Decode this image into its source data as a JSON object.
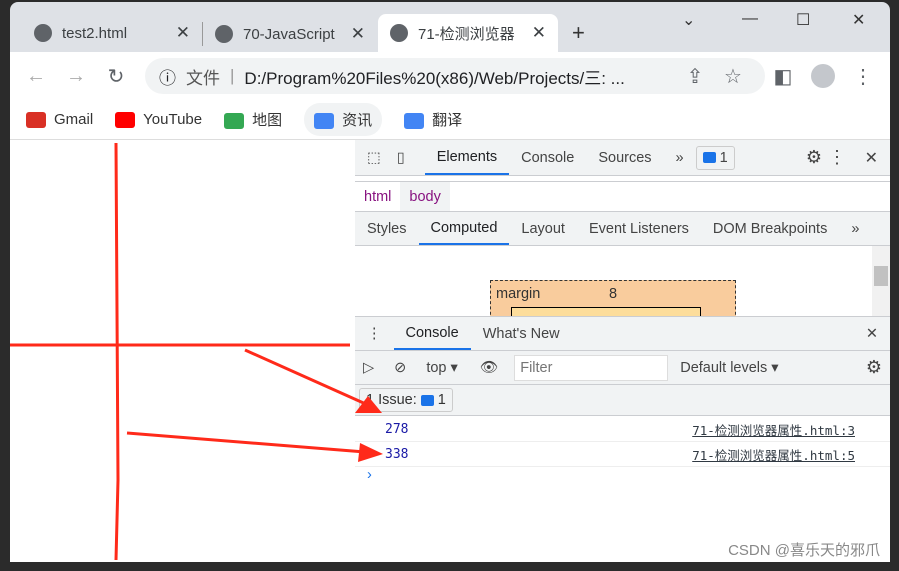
{
  "tabs": [
    {
      "title": "test2.html"
    },
    {
      "title": "70-JavaScript"
    },
    {
      "title": "71-检测浏览器",
      "active": true
    }
  ],
  "omnibox": {
    "security_label": "文件",
    "url": "D:/Program%20Files%20(x86)/Web/Projects/三: ..."
  },
  "bookmarks": [
    {
      "label": "Gmail",
      "color": "#d93025"
    },
    {
      "label": "YouTube",
      "color": "#ff0000"
    },
    {
      "label": "地图",
      "color": "#34a853"
    },
    {
      "label": "资讯",
      "color": "#4285f4"
    },
    {
      "label": "翻译",
      "color": "#4285f4"
    }
  ],
  "devtools": {
    "main_tabs": [
      "Elements",
      "Console",
      "Sources"
    ],
    "issues_count": "1",
    "breadcrumb": [
      "html",
      "body"
    ],
    "sub_tabs": [
      "Styles",
      "Computed",
      "Layout",
      "Event Listeners",
      "DOM Breakpoints"
    ],
    "box_model": {
      "label": "margin",
      "value": "8"
    },
    "drawer_tabs": [
      "Console",
      "What's New"
    ],
    "context": "top",
    "filter_placeholder": "Filter",
    "levels": "Default levels",
    "issues_label": "1 Issue:",
    "logs": [
      {
        "value": "278",
        "source": "71-检测浏览器属性.html:3"
      },
      {
        "value": "338",
        "source": "71-检测浏览器属性.html:5"
      }
    ]
  },
  "watermark": "CSDN @喜乐天的邪爪",
  "annotation_color": "#ff2a1a"
}
